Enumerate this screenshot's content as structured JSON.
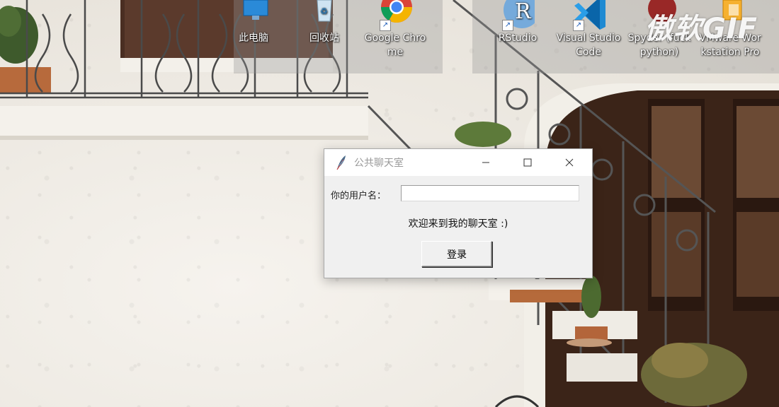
{
  "desktop": {
    "icons": [
      {
        "label": "此电脑",
        "icon": "computer-icon"
      },
      {
        "label": "回收站",
        "icon": "recycle-bin-icon"
      },
      {
        "label": "Google Chrome",
        "icon": "chrome-icon"
      },
      {
        "label": "RStudio",
        "icon": "rstudio-icon"
      },
      {
        "label": "Visual Studio Code",
        "icon": "vscode-icon"
      },
      {
        "label": "Spyder (fuck python)",
        "icon": "spyder-icon"
      },
      {
        "label": "VMware Workstation Pro",
        "icon": "vmware-icon"
      }
    ],
    "watermark": "傲软GIF"
  },
  "window": {
    "title": "公共聊天室",
    "username_label": "你的用户名：",
    "username_value": "",
    "welcome_text": "欢迎来到我的聊天室 :)",
    "login_button": "登录"
  },
  "colors": {
    "titlebar": "#ffffff",
    "title_text": "#999999",
    "window_bg": "#f0f0f0",
    "rstudio": "#75aadb",
    "vscode": "#1f8ad2",
    "chrome_red": "#db4437",
    "chrome_yellow": "#f4b400",
    "chrome_green": "#0f9d58",
    "chrome_blue": "#4285f4"
  }
}
